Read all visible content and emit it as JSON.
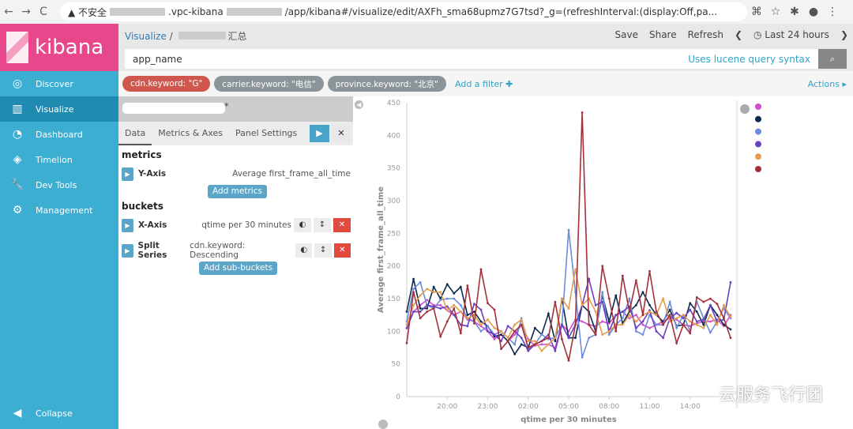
{
  "browser": {
    "back": "←",
    "forward": "→",
    "reload": "C",
    "security": "▲ 不安全",
    "url_host": ".vpc-kibana",
    "url_path": "/app/kibana#/visualize/edit/AXFh_sma68upmz7G7tsd?_g=(refreshInterval:(display:Off,pa..."
  },
  "sidebar": {
    "logo": "kibana",
    "items": [
      {
        "label": "Discover",
        "icon": "compass-icon",
        "glyph": "◎"
      },
      {
        "label": "Visualize",
        "icon": "bar-chart-icon",
        "glyph": "▥"
      },
      {
        "label": "Dashboard",
        "icon": "dashboard-icon",
        "glyph": "◔"
      },
      {
        "label": "Timelion",
        "icon": "timelion-icon",
        "glyph": "◈"
      },
      {
        "label": "Dev Tools",
        "icon": "wrench-icon",
        "glyph": "🔧"
      },
      {
        "label": "Management",
        "icon": "gear-icon",
        "glyph": "⚙"
      }
    ],
    "collapse": "Collapse"
  },
  "topbar": {
    "breadcrumb_root": "Visualize",
    "breadcrumb_sep": "/",
    "breadcrumb_suffix": "汇总",
    "save": "Save",
    "share": "Share",
    "refresh": "Refresh",
    "prev": "❮",
    "time": "◷ Last 24 hours",
    "next": "❯"
  },
  "query": {
    "value": "app_name",
    "hint": "Uses lucene query syntax"
  },
  "filters": [
    {
      "label": "cdn.keyword: \"G\"",
      "color": "#d0574e"
    },
    {
      "label": "carrier.keyword: \"电信\"",
      "color": "#8a9499"
    },
    {
      "label": "province.keyword: \"北京\"",
      "color": "#8a9499"
    }
  ],
  "add_filter": "Add a filter ✚",
  "actions": "Actions ▸",
  "editor": {
    "title_suffix": "*",
    "tabs": [
      "Data",
      "Metrics & Axes",
      "Panel Settings"
    ],
    "metrics_heading": "metrics",
    "yaxis_label": "Y-Axis",
    "yaxis_value": "Average first_frame_all_time",
    "add_metrics": "Add metrics",
    "buckets_heading": "buckets",
    "xaxis_label": "X-Axis",
    "xaxis_value": "qtime per 30 minutes",
    "split_label": "Split Series",
    "split_value": "cdn.keyword: Descending",
    "add_sub_buckets": "Add sub-buckets"
  },
  "chart_data": {
    "type": "line",
    "xlabel": "qtime per 30 minutes",
    "ylabel": "Average first_frame_all_time",
    "ylim": [
      0,
      450
    ],
    "yticks": [
      0,
      50,
      100,
      150,
      200,
      250,
      300,
      350,
      400,
      450
    ],
    "xticks": [
      "20:00",
      "23:00",
      "02:00",
      "05:00",
      "08:00",
      "11:00",
      "14:00"
    ],
    "grid": false,
    "legend": "right",
    "series": [
      {
        "color": "#d04fcf",
        "values": [
          105,
          130,
          140,
          148,
          140,
          140,
          132,
          125,
          130,
          118,
          115,
          108,
          100,
          88,
          95,
          85,
          95,
          110,
          88,
          78,
          80,
          80,
          75,
          110,
          100,
          118,
          115,
          110,
          108,
          115,
          112,
          125,
          130,
          120,
          125,
          110,
          105,
          110,
          115,
          120,
          118,
          110,
          108,
          112,
          115,
          115,
          118,
          108,
          125
        ]
      },
      {
        "color": "#0b2a4e",
        "values": [
          130,
          180,
          135,
          135,
          168,
          150,
          172,
          158,
          168,
          125,
          130,
          115,
          108,
          92,
          95,
          85,
          65,
          80,
          75,
          105,
          95,
          127,
          85,
          150,
          90,
          90,
          140,
          130,
          100,
          155,
          115,
          155,
          112,
          130,
          140,
          160,
          140,
          125,
          115,
          133,
          108,
          110,
          143,
          130,
          110,
          140,
          125,
          110,
          103
        ]
      },
      {
        "color": "#6f8bdc",
        "values": [
          115,
          165,
          175,
          140,
          135,
          148,
          150,
          150,
          140,
          120,
          115,
          100,
          108,
          95,
          100,
          90,
          80,
          120,
          72,
          80,
          95,
          88,
          90,
          110,
          255,
          160,
          60,
          90,
          95,
          160,
          95,
          110,
          120,
          150,
          100,
          95,
          125,
          110,
          110,
          145,
          105,
          125,
          100,
          145,
          120,
          98,
          115,
          135,
          120
        ]
      },
      {
        "color": "#6a3fc0",
        "values": [
          105,
          130,
          130,
          140,
          138,
          135,
          138,
          125,
          110,
          108,
          142,
          133,
          100,
          95,
          85,
          108,
          100,
          90,
          70,
          80,
          85,
          95,
          70,
          110,
          90,
          110,
          140,
          180,
          140,
          145,
          100,
          125,
          130,
          138,
          105,
          115,
          132,
          100,
          90,
          120,
          128,
          120,
          133,
          115,
          118,
          140,
          115,
          118,
          175
        ]
      },
      {
        "color": "#e39c4c",
        "values": [
          110,
          140,
          155,
          165,
          160,
          160,
          132,
          140,
          130,
          120,
          125,
          110,
          118,
          105,
          100,
          90,
          110,
          118,
          85,
          85,
          70,
          80,
          90,
          150,
          135,
          195,
          140,
          150,
          130,
          95,
          100,
          110,
          110,
          125,
          115,
          125,
          130,
          125,
          150,
          115,
          120,
          125,
          115,
          110,
          105,
          125,
          110,
          140,
          122
        ]
      },
      {
        "color": "#a3303a",
        "values": [
          82,
          160,
          120,
          130,
          135,
          92,
          115,
          135,
          97,
          170,
          112,
          195,
          143,
          133,
          73,
          85,
          100,
          110,
          75,
          80,
          85,
          90,
          145,
          88,
          55,
          110,
          435,
          110,
          95,
          200,
          150,
          100,
          185,
          130,
          178,
          125,
          192,
          130,
          110,
          125,
          82,
          110,
          97,
          152,
          145,
          150,
          142,
          120,
          90
        ]
      }
    ]
  },
  "watermark": "云服务飞行团"
}
